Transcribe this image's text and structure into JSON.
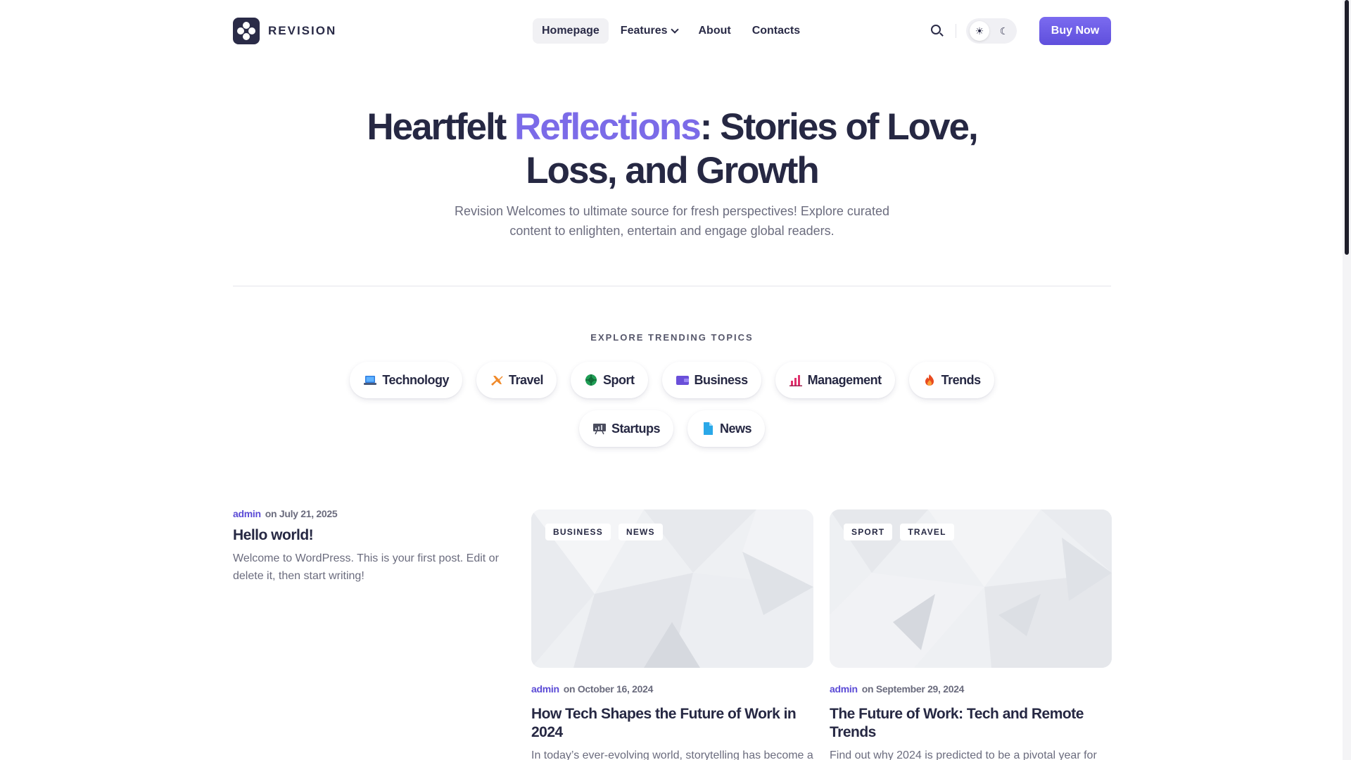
{
  "brand": {
    "name": "REVISION"
  },
  "nav": {
    "items": [
      {
        "label": "Homepage",
        "active": true
      },
      {
        "label": "Features",
        "has_dropdown": true
      },
      {
        "label": "About"
      },
      {
        "label": "Contacts"
      }
    ]
  },
  "header": {
    "search_icon": "search-icon",
    "theme_light_icon": "sun-icon",
    "theme_dark_icon": "moon-icon",
    "buy_label": "Buy Now"
  },
  "hero": {
    "title_before": "Heartfelt ",
    "title_accent": "Reflections",
    "title_after": ": Stories of Love, Loss, and Growth",
    "subtitle": "Revision Welcomes to ultimate source for fresh perspectives! Explore curated content to enlighten, entertain and engage global readers."
  },
  "topics": {
    "label": "EXPLORE TRENDING TOPICS",
    "items": [
      {
        "label": "Technology",
        "icon": "laptop-icon"
      },
      {
        "label": "Travel",
        "icon": "airplane-icon"
      },
      {
        "label": "Sport",
        "icon": "ball-icon"
      },
      {
        "label": "Business",
        "icon": "wallet-icon"
      },
      {
        "label": "Management",
        "icon": "bar-chart-icon"
      },
      {
        "label": "Trends",
        "icon": "fire-icon"
      },
      {
        "label": "Startups",
        "icon": "presentation-icon"
      },
      {
        "label": "News",
        "icon": "document-icon"
      }
    ]
  },
  "posts": [
    {
      "author": "admin",
      "date": "on July 21, 2025",
      "title": "Hello world!",
      "excerpt": "Welcome to WordPress. This is your first post. Edit or delete it, then start writing!"
    },
    {
      "tags": [
        "BUSINESS",
        "NEWS"
      ],
      "author": "admin",
      "date": "on October 16, 2024",
      "title": "How Tech Shapes the Future of Work in 2024",
      "excerpt": "In today’s ever-evolving world, storytelling has become a"
    },
    {
      "tags": [
        "SPORT",
        "TRAVEL"
      ],
      "author": "admin",
      "date": "on September 29, 2024",
      "title": "The Future of Work: Tech and Remote Trends",
      "excerpt": "Find out why 2024 is predicted to be a pivotal year for"
    }
  ],
  "colors": {
    "accent": "#7b6be8",
    "button": "#6655e0",
    "heading": "#262843",
    "muted": "#6b6c7e",
    "author": "#5b4bd6"
  }
}
